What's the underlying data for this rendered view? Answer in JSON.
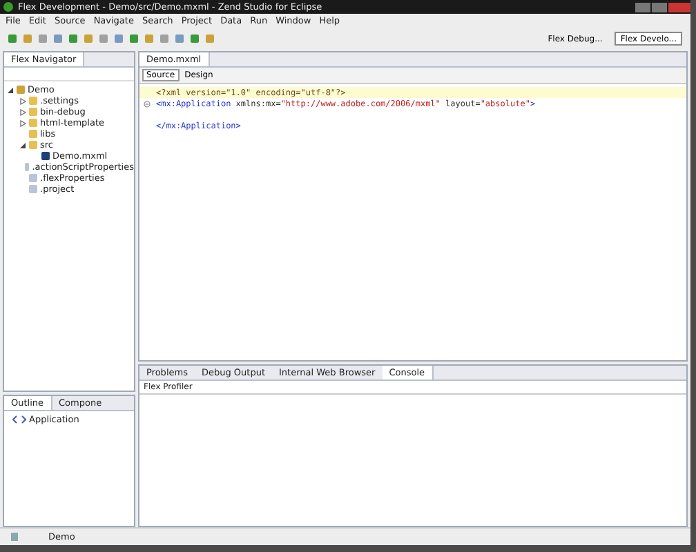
{
  "window": {
    "title": "Flex Development - Demo/src/Demo.mxml - Zend Studio for Eclipse"
  },
  "menu": [
    "File",
    "Edit",
    "Source",
    "Navigate",
    "Search",
    "Project",
    "Data",
    "Run",
    "Window",
    "Help"
  ],
  "perspectives": [
    {
      "label": "Flex Debug...",
      "selected": false
    },
    {
      "label": "Flex Develo...",
      "selected": true
    }
  ],
  "navigator": {
    "title": "Flex Navigator",
    "tree": [
      {
        "label": "Demo",
        "kind": "project",
        "expanded": true,
        "children": [
          {
            "label": ".settings",
            "kind": "folder",
            "expanded": false
          },
          {
            "label": "bin-debug",
            "kind": "folder",
            "expanded": false
          },
          {
            "label": "html-template",
            "kind": "folder",
            "expanded": false
          },
          {
            "label": "libs",
            "kind": "folder"
          },
          {
            "label": "src",
            "kind": "folder",
            "expanded": true,
            "children": [
              {
                "label": "Demo.mxml",
                "kind": "mxml"
              }
            ]
          },
          {
            "label": ".actionScriptProperties",
            "kind": "file"
          },
          {
            "label": ".flexProperties",
            "kind": "file"
          },
          {
            "label": ".project",
            "kind": "file"
          }
        ]
      }
    ]
  },
  "editor": {
    "tab": "Demo.mxml",
    "modes": [
      {
        "label": "Source",
        "selected": true
      },
      {
        "label": "Design",
        "selected": false
      }
    ],
    "lines": [
      {
        "current": true,
        "tokens": [
          {
            "kind": "pi",
            "t": "<?xml version=\"1.0\" encoding=\"utf-8\"?>"
          }
        ]
      },
      {
        "fold": true,
        "tokens": [
          {
            "kind": "tag",
            "t": "<mx:Application"
          },
          {
            "kind": "attr",
            "t": " xmlns:mx="
          },
          {
            "kind": "val",
            "t": "\"http://www.adobe.com/2006/mxml\""
          },
          {
            "kind": "attr",
            "t": " layout="
          },
          {
            "kind": "val",
            "t": "\"absolute\""
          },
          {
            "kind": "tag",
            "t": ">"
          }
        ]
      },
      {
        "gap_before": true,
        "tokens": [
          {
            "kind": "tag",
            "t": "</mx:Application>"
          }
        ]
      }
    ]
  },
  "outline": {
    "tabs": [
      {
        "label": "Outline",
        "selected": true
      },
      {
        "label": "Compone",
        "selected": false
      }
    ],
    "items": [
      "Application"
    ]
  },
  "bottom": {
    "tabs": [
      {
        "label": "Problems",
        "selected": false
      },
      {
        "label": "Debug Output",
        "selected": false
      },
      {
        "label": "Internal Web Browser",
        "selected": false
      },
      {
        "label": "Console",
        "selected": true
      }
    ],
    "console_title": "Flex Profiler"
  },
  "status": {
    "text": "Demo"
  }
}
